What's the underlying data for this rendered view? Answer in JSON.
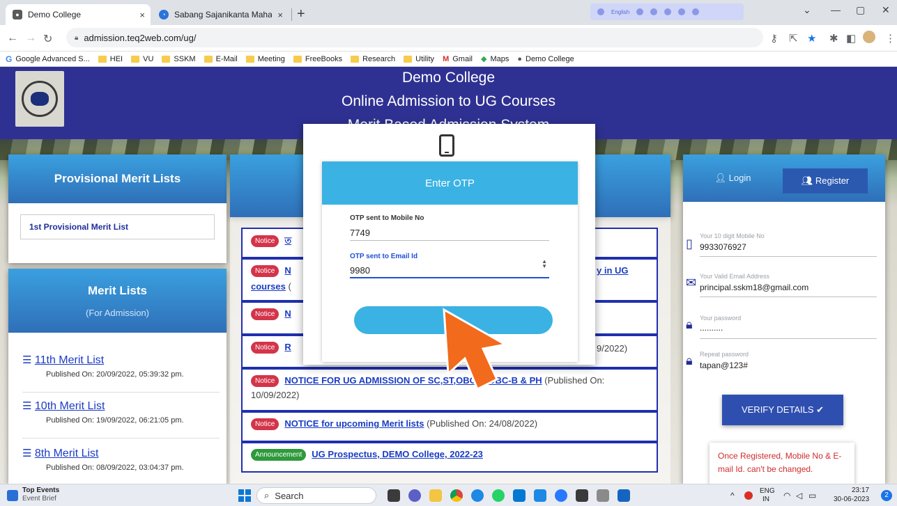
{
  "browser": {
    "tabs": [
      {
        "title": "Demo College",
        "close": "×"
      },
      {
        "title": "Sabang Sajanikanta Mahavidyala",
        "close": "×"
      }
    ],
    "new_tab": "+",
    "lang_strip_label": "English",
    "url": "admission.teq2web.com/ug/",
    "bookmarks": [
      "Google Advanced S...",
      "HEI",
      "VU",
      "SSKM",
      "E-Mail",
      "Meeting",
      "FreeBooks",
      "Research",
      "Utility",
      "Gmail",
      "Maps",
      "Demo College"
    ]
  },
  "header": {
    "line1": "Demo College",
    "line2": "Online Admission to UG Courses",
    "line3": "Merit Based Admission System"
  },
  "left": {
    "provisional_title": "Provisional Merit Lists",
    "provisional_item": "1st Provisional Merit List",
    "merit_title": "Merit Lists",
    "merit_sub": "(For Admission)",
    "merit_items": [
      {
        "label": "11th Merit List",
        "published": "Published On: 20/09/2022, 05:39:32 pm."
      },
      {
        "label": "10th Merit List",
        "published": "Published On: 19/09/2022, 06:21:05 pm."
      },
      {
        "label": "8th Merit List",
        "published": "Published On: 08/09/2022, 03:04:37 pm."
      }
    ]
  },
  "notices": [
    {
      "tag": "Notice",
      "link": "ত",
      "published": ""
    },
    {
      "tag": "Notice",
      "link": "N",
      "link_tail": "y in UG",
      "link_line2": "courses",
      "published": "("
    },
    {
      "tag": "Notice",
      "link": "N",
      "published": ""
    },
    {
      "tag": "Notice",
      "link": "R",
      "published": "9/2022)"
    },
    {
      "tag": "Notice",
      "link": "NOTICE FOR UG ADMISSION OF SC,ST,OBC-A,OBC-B & PH",
      "published": "(Published On:",
      "published_line2": "10/09/2022)"
    },
    {
      "tag": "Notice",
      "link": "NOTICE for upcoming Merit lists",
      "published": "(Published On: 24/08/2022)"
    },
    {
      "tag": "Announcement",
      "link": "UG Prospectus, DEMO College, 2022-23",
      "published": ""
    }
  ],
  "right": {
    "login_label": "Login",
    "register_label": "Register",
    "mobile_label": "Your 10 digit Mobile No",
    "mobile_value": "9933076927",
    "email_label": "Your Valid Email Address",
    "email_value": "principal.sskm18@gmail.com",
    "password_label": "Your password",
    "password_value": "..........",
    "repeat_label": "Repeat password",
    "repeat_value": "tapan@123#",
    "verify_label": "VERIFY DETAILS ✔",
    "warning": "Once Registered, Mobile No & E-mail Id. can't be changed."
  },
  "modal": {
    "title": "Enter OTP",
    "mobile_label": "OTP sent to Mobile No",
    "mobile_value": "7749",
    "email_label": "OTP sent to Email Id",
    "email_value": "9980",
    "submit_label": "S"
  },
  "taskbar": {
    "top_events": "Top Events",
    "event_brief": "Event Brief",
    "search": "Search",
    "lang": "ENG",
    "region": "IN",
    "time": "23:17",
    "date": "30-06-2023",
    "badge": "2"
  },
  "colors": {
    "header_bg": "#2f3192",
    "panel_head": "#3aa0df",
    "otp_head": "#3bb2e4",
    "notice_tag": "#d4344a",
    "announcement_tag": "#2e9a3c",
    "arrow": "#f26a1b",
    "verify_btn": "#2f4fb0"
  }
}
